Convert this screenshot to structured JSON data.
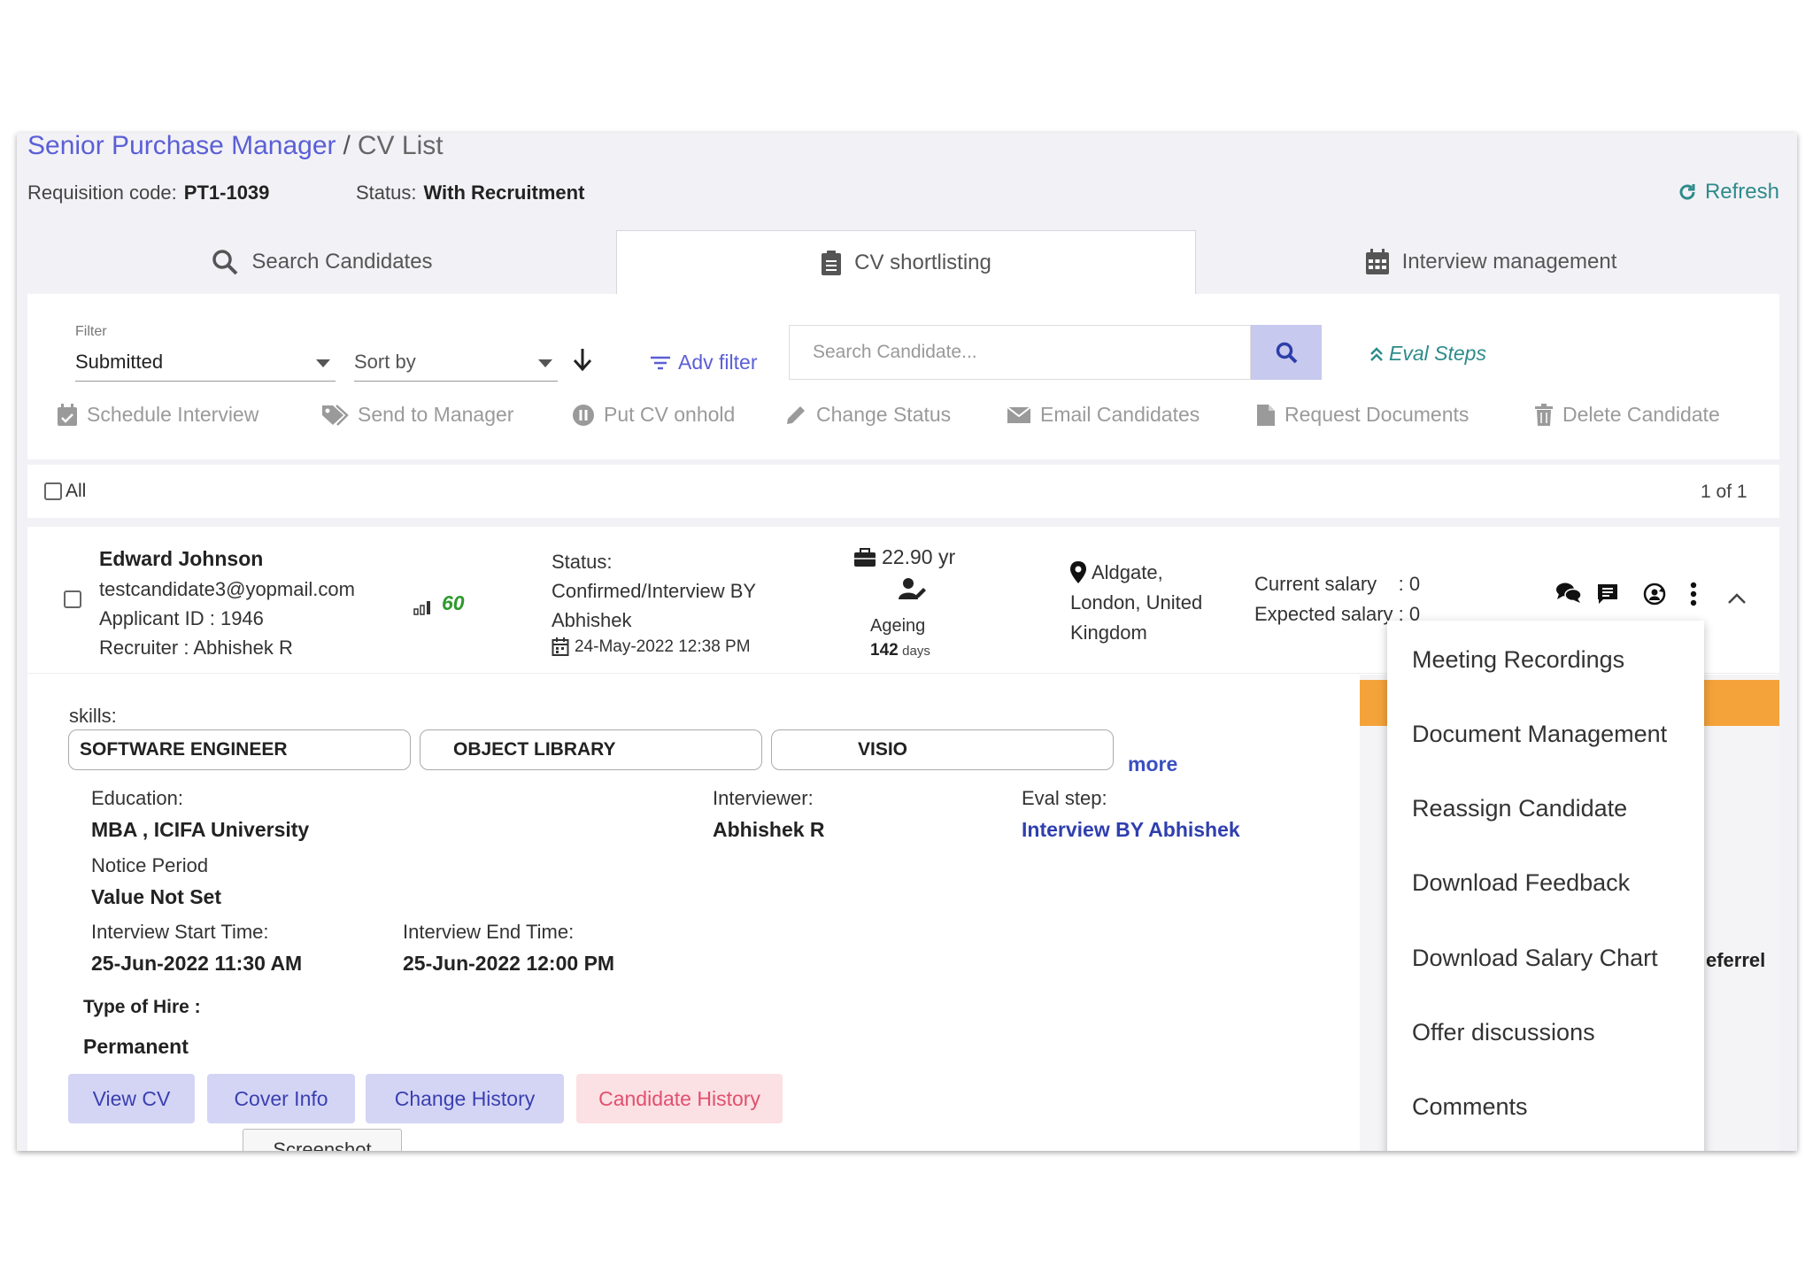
{
  "breadcrumb": {
    "parent": "Senior Purchase Manager",
    "separator": "/",
    "current": "CV List"
  },
  "requisition": {
    "code_label": "Requisition code:",
    "code_value": "PT1-1039",
    "status_label": "Status:",
    "status_value": "With Recruitment"
  },
  "refresh_label": "Refresh",
  "tabs": [
    {
      "label": "Search Candidates",
      "icon": "search-icon"
    },
    {
      "label": "CV shortlisting",
      "icon": "clipboard-icon",
      "active": true
    },
    {
      "label": "Interview management",
      "icon": "calendar-icon"
    }
  ],
  "filters": {
    "filter_label": "Filter",
    "filter_value": "Submitted",
    "sort_placeholder": "Sort by",
    "adv_filter": "Adv filter",
    "search_placeholder": "Search Candidate...",
    "eval_steps": "Eval Steps"
  },
  "actions": [
    {
      "label": "Schedule Interview",
      "icon": "calendar-check-icon"
    },
    {
      "label": "Send to Manager",
      "icon": "tags-icon"
    },
    {
      "label": "Put CV onhold",
      "icon": "pause-icon"
    },
    {
      "label": "Change Status",
      "icon": "pencil-icon"
    },
    {
      "label": "Email Candidates",
      "icon": "envelope-icon"
    },
    {
      "label": "Request Documents",
      "icon": "document-icon"
    },
    {
      "label": "Delete Candidate",
      "icon": "trash-icon"
    }
  ],
  "list": {
    "all_label": "All",
    "pagination": "1 of 1"
  },
  "candidate": {
    "name": "Edward Johnson",
    "email": "testcandidate3@yopmail.com",
    "applicant_id": "Applicant ID : 1946",
    "recruiter": "Recruiter : Abhishek R",
    "score": "60",
    "status_label": "Status:",
    "status_line1": "Confirmed/Interview BY",
    "status_line2": "Abhishek",
    "status_date": "24-May-2022 12:38 PM",
    "experience": "22.90 yr",
    "ageing_label": "Ageing",
    "ageing_value": "142",
    "ageing_unit": "days",
    "location_line1": "Aldgate,",
    "location_line2": "London, United",
    "location_line3": "Kingdom",
    "current_salary": "Current salary    : 0",
    "expected_salary": "Expected salary : 0",
    "skills_label": "skills:",
    "skills": [
      "SOFTWARE ENGINEER",
      "OBJECT LIBRARY",
      "VISIO"
    ],
    "more": "more",
    "education_label": "Education:",
    "education_value": "MBA , ICIFA University",
    "interviewer_label": "Interviewer:",
    "interviewer_value": "Abhishek R",
    "eval_label": "Eval step:",
    "eval_value": "Interview BY Abhishek",
    "notice_label": "Notice Period",
    "notice_value": "Value Not Set",
    "start_label": "Interview Start Time:",
    "start_value": "25-Jun-2022 11:30 AM",
    "end_label": "Interview End Time:",
    "end_value": "25-Jun-2022 12:00 PM",
    "hire_label": "Type of Hire :",
    "hire_value": "Permanent",
    "referral_partial": "eferrel",
    "buttons": [
      "View CV",
      "Cover Info",
      "Change History",
      "Candidate History"
    ],
    "tooltip": "Screenshot"
  },
  "menu": {
    "items": [
      "Meeting Recordings",
      "Document Management",
      "Reassign Candidate",
      "Download Feedback",
      "Download Salary Chart",
      "Offer discussions",
      "Comments"
    ]
  },
  "colors": {
    "accent": "#5b5fd6",
    "teal": "#2e8b8b",
    "orange": "#f4a33a",
    "button_bg": "#d4d5f5",
    "danger": "#e0506e"
  }
}
